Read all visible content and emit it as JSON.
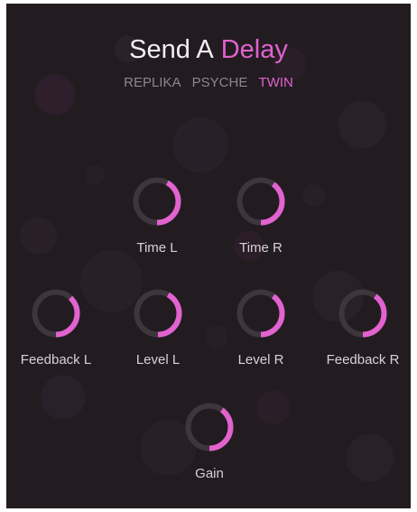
{
  "header": {
    "prefix": "Send A",
    "name": "Delay"
  },
  "tabs": [
    {
      "label": "REPLIKA",
      "active": false
    },
    {
      "label": "PSYCHE",
      "active": false
    },
    {
      "label": "TWIN",
      "active": true
    }
  ],
  "colors": {
    "accent": "#e262cf",
    "track": "#3d373d",
    "text": "#d6d2d6",
    "inactive_tab": "#8c878c",
    "background": "#221c21"
  },
  "knobs": [
    {
      "id": "time-l",
      "label": "Time L",
      "level": 0.42
    },
    {
      "id": "time-r",
      "label": "Time R",
      "level": 0.4
    },
    {
      "id": "feedback-l",
      "label": "Feedback L",
      "level": 0.38
    },
    {
      "id": "level-l",
      "label": "Level L",
      "level": 0.42
    },
    {
      "id": "level-r",
      "label": "Level R",
      "level": 0.4
    },
    {
      "id": "feedback-r",
      "label": "Feedback R",
      "level": 0.4
    },
    {
      "id": "gain",
      "label": "Gain",
      "level": 0.4
    }
  ]
}
